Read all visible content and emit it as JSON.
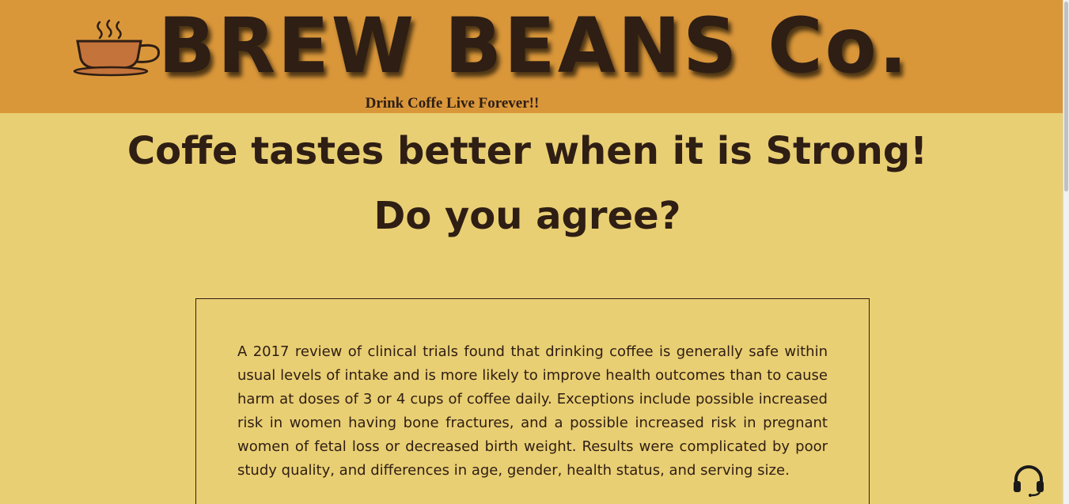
{
  "header": {
    "brand": "BREW BEANS Co.",
    "tagline": "Drink Coffe Live Forever!!",
    "logo_icon": "coffee-cup-icon",
    "background": "#DA973A"
  },
  "hero": {
    "headline_prefix": "Coffe tastes better when it is ",
    "headline_strong": "Strong!",
    "subhead": "Do you agree?"
  },
  "info": {
    "paragraph": "A 2017 review of clinical trials found that drinking coffee is generally safe within usual levels of intake and is more likely to improve health outcomes than to cause harm at doses of 3 or 4 cups of coffee daily. Exceptions include possible increased risk in women having bone fractures, and a possible increased risk in pregnant women of fetal loss or decreased birth weight. Results were complicated by poor study quality, and differences in age, gender, health status, and serving size."
  },
  "widgets": {
    "support_icon": "headset-icon"
  },
  "colors": {
    "page_background": "#E9CF73",
    "text_dark": "#2E1E14",
    "cup_fill": "#C4733A"
  }
}
